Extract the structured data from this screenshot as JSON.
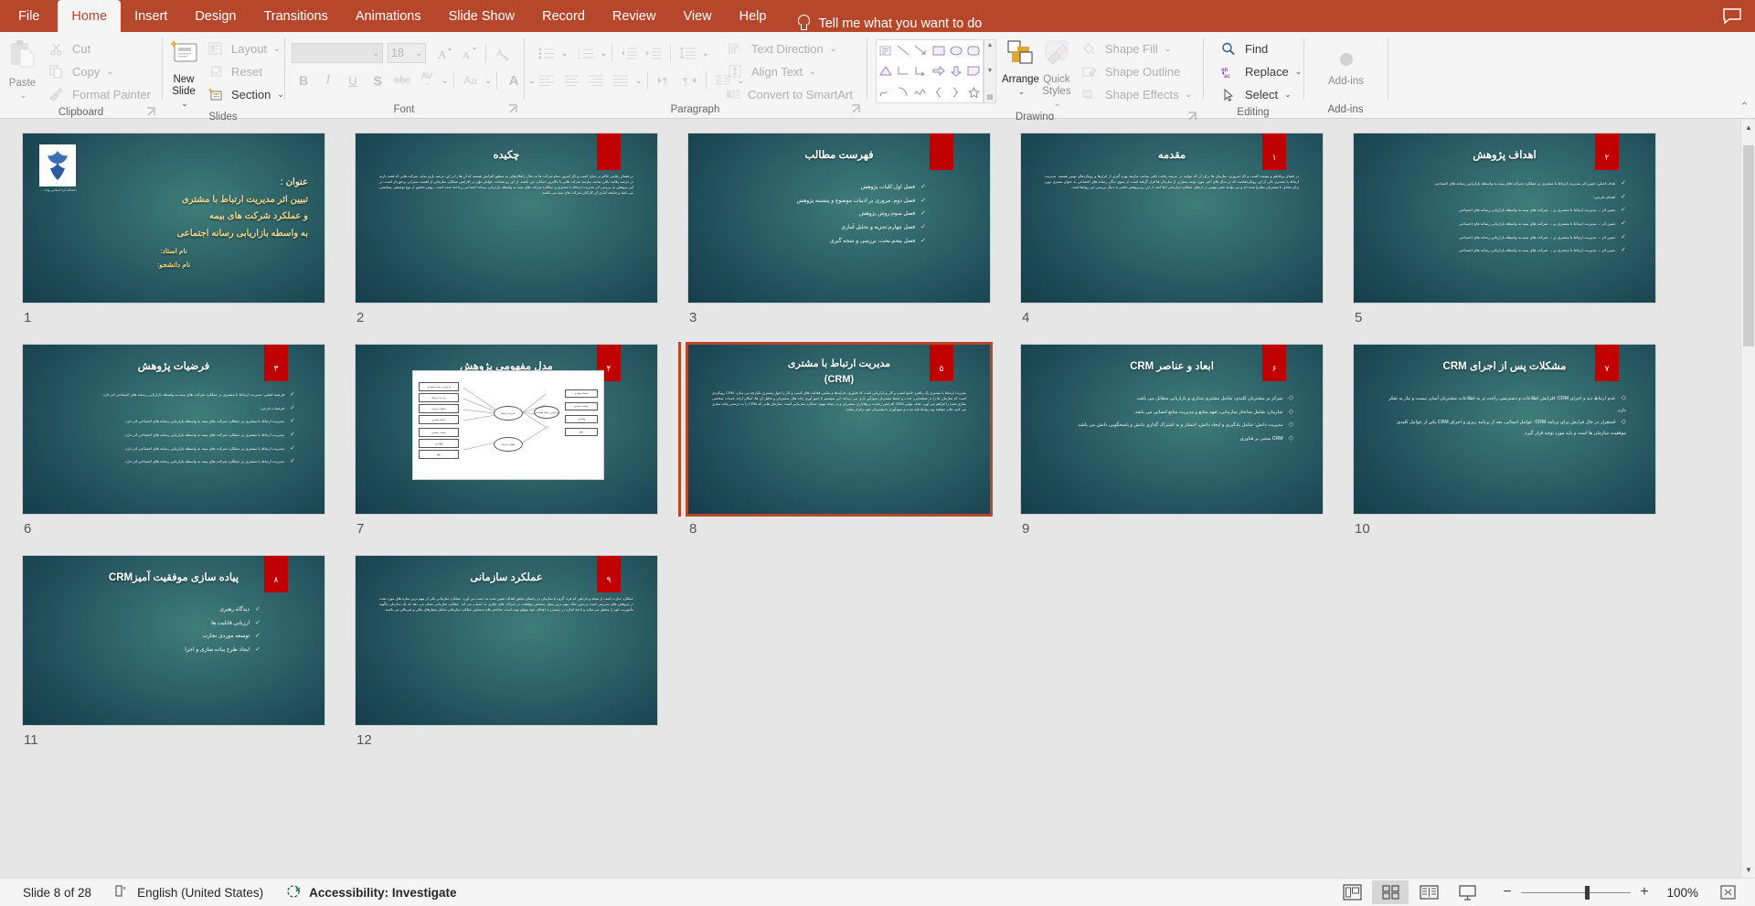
{
  "tabs": [
    {
      "label": "File",
      "active": false
    },
    {
      "label": "Home",
      "active": true
    },
    {
      "label": "Insert",
      "active": false
    },
    {
      "label": "Design",
      "active": false
    },
    {
      "label": "Transitions",
      "active": false
    },
    {
      "label": "Animations",
      "active": false
    },
    {
      "label": "Slide Show",
      "active": false
    },
    {
      "label": "Record",
      "active": false
    },
    {
      "label": "Review",
      "active": false
    },
    {
      "label": "View",
      "active": false
    },
    {
      "label": "Help",
      "active": false
    }
  ],
  "tellme": "Tell me what you want to do",
  "ribbon": {
    "clipboard": {
      "label": "Clipboard",
      "paste": "Paste",
      "cut": "Cut",
      "copy": "Copy",
      "format_painter": "Format Painter"
    },
    "slides": {
      "label": "Slides",
      "new_slide_l1": "New",
      "new_slide_l2": "Slide",
      "layout": "Layout",
      "reset": "Reset",
      "section": "Section"
    },
    "font": {
      "label": "Font",
      "font_name": "",
      "font_size": "18",
      "bold": "B",
      "italic": "I",
      "underline": "U",
      "shadow": "S",
      "strike": "abc",
      "char_spacing": "AV",
      "change_case": "Aa",
      "font_color": "A"
    },
    "paragraph": {
      "label": "Paragraph",
      "text_direction": "Text Direction",
      "align_text": "Align Text",
      "convert_smartart": "Convert to SmartArt"
    },
    "drawing": {
      "label": "Drawing",
      "arrange": "Arrange",
      "quick_styles_l1": "Quick",
      "quick_styles_l2": "Styles",
      "shape_fill": "Shape Fill",
      "shape_outline": "Shape Outline",
      "shape_effects": "Shape Effects"
    },
    "editing": {
      "label": "Editing",
      "find": "Find",
      "replace": "Replace",
      "select": "Select"
    },
    "addins": {
      "label": "Add-ins",
      "button": "Add-ins"
    }
  },
  "status": {
    "slide_indicator": "Slide 8 of 28",
    "language": "English (United States)",
    "accessibility": "Accessibility: Investigate",
    "zoom": "100%"
  },
  "slides": [
    {
      "number": "1",
      "kind": "title",
      "badge": "",
      "logo_caption": "دانشگاه آزاد اسلامی\nواحد ...",
      "title_label": "عنوان :",
      "title_lines": [
        "تبیین اثر مدیریت ارتباط با مشتری",
        "و عملکرد شرکت های بیمه",
        "به واسطه بازاریابی رسانه اجتماعی"
      ],
      "footer_lines": [
        "نام استاد:",
        "نام دانشجو:"
      ]
    },
    {
      "number": "2",
      "kind": "text",
      "badge": "",
      "title": "چکیده",
      "body": "در فضای رقابتی حاکم بر دنیای کسب و کار امروز، تمام شرکت ها به دنبال راهکارهایی به منظور افزایش هستند که آن ها را در این عرصه یاری نماید. شرکت هایی که قصد دارند در عرصه رقابت باقی بمانند، نیازمند شرکت هایی با بالاترین عملکرد می باشند. از این رو شناخت عوامل مؤثر در افزایش عملکرد سازمانی از اهمیت بسزایی برخوردار است. در این پژوهش به بررسی اثر مدیریت ارتباط با مشتری و عملکرد شرکت های بیمه به واسطه بازاریابی رسانه اجتماعی پرداخته شده است. روش تحقیق از نوع توصیفی پیمایشی می باشد و جامعه آماری آن کارکنان شرکت های بیمه می باشند."
    },
    {
      "number": "3",
      "kind": "bullets",
      "badge": "",
      "title": "فهرست مطالب",
      "bullets": [
        "فصل اول:کلیات پژوهش",
        "فصل دوم: مروری بر ادبیات موضوع و پیشینه پژوهش",
        "فصل سوم:روش پژوهش",
        "فصل چهارم:تجزیه و تحلیل آماری",
        "فصل پنجم:بحث، بررسی و نتیجه گیری"
      ]
    },
    {
      "number": "4",
      "kind": "text",
      "badge": "۱",
      "title": "مقدمه",
      "body": "در فضای پرتلاطم و پیچیده کسب و کار امروزی، سازمان ها برای آن که بتوانند در عرصه رقابت باقی بمانند، نیازمند بهره گیری از ابزارها و رویکردهای نوینی هستند. مدیریت ارتباط با مشتری یکی از این رویکردهاست که در سال های اخیر مورد توجه بسیاری از سازمان ها قرار گرفته است. از سوی دیگر، رسانه های اجتماعی به عنوان بستری نوین برای تعامل با مشتریان مطرح شده اند و می توانند نقش مهمی در ارتقای عملکرد سازمانی ایفا کنند. از این رو پژوهش حاضر به دنبال بررسی این روابط است."
    },
    {
      "number": "5",
      "kind": "bullets",
      "badge": "۲",
      "title": "اهداف پژوهش",
      "bullets": [
        "هدف اصلی: تعیین اثر مدیریت ارتباط با مشتری بر عملکرد شرکت های بیمه به واسطه بازاریابی رسانه های اجتماعی",
        "اهداف فرعی:",
        "تعیین اثر ... مدیریت ارتباط با مشتری بر ... شرکت های بیمه به واسطه بازاریابی رسانه های اجتماعی",
        "تعیین اثر ... مدیریت ارتباط با مشتری بر ... شرکت های بیمه به واسطه بازاریابی رسانه های اجتماعی",
        "تعیین اثر ... مدیریت ارتباط با مشتری بر ... شرکت های بیمه به واسطه بازاریابی رسانه های اجتماعی",
        "تعیین اثر ... مدیریت ارتباط با مشتری بر ... شرکت های بیمه به واسطه بازاریابی رسانه های اجتماعی"
      ]
    },
    {
      "number": "6",
      "kind": "bullets",
      "badge": "۳",
      "title": "فرضیات پژوهش",
      "bullets": [
        "فرضیه اصلی: مدیریت ارتباط با مشتری بر عملکرد شرکت های بیمه به واسطه بازاریابی رسانه های اجتماعی اثر دارد.",
        "فرضیات فرعی:",
        "مدیریت ارتباط با مشتری بر عملکرد شرکت های بیمه به واسطه بازاریابی رسانه های اجتماعی اثر دارد.",
        "مدیریت ارتباط با مشتری بر عملکرد شرکت های بیمه به واسطه بازاریابی رسانه های اجتماعی اثر دارد.",
        "مدیریت ارتباط با مشتری بر عملکرد شرکت های بیمه به واسطه بازاریابی رسانه های اجتماعی اثر دارد.",
        "مدیریت ارتباط با مشتری بر عملکرد شرکت های بیمه به واسطه بازاریابی رسانه های اجتماعی اثر دارد."
      ]
    },
    {
      "number": "7",
      "kind": "diagram",
      "badge": "۴",
      "title": "مدل مفهومی پژوهش",
      "diagram_nodes": [
        "بازاریابی رسانه اجتماعی",
        "مدیریت ارتباط",
        "عملکرد شرکت",
        "اعتماد مشتری",
        "رضایت مشتری",
        "وفاداری",
        "تعهد",
        "کیفیت خدمات"
      ]
    },
    {
      "number": "8",
      "kind": "text",
      "badge": "۵",
      "selected": true,
      "title_line1": "مدیریت ارتباط با مشتری",
      "title_line2": "(CRM)",
      "body": "مدیریت ارتباط با مشتری یک راهبرد جامع کسب و کار و بازاریابی است که فناوری، فرآیندها و تمامی فعالیت های کسب و کار را حول مشتری یکپارچه می سازد. CRM رویکردی است که سازمان ها را در شناسایی، جذب و حفظ مشتریان سودآور یاری می رساند. این سیستم با جمع آوری داده های مشتریان و تحلیل آن ها، امکان ارائه خدمات شخصی سازی شده را فراهم می آورد. هدف نهایی CRM افزایش رضایت و وفاداری مشتریان و در نتیجه بهبود عملکرد سازمانی است. سازمان هایی که CRM را به درستی پیاده سازی می کنند، قادر خواهند بود روابط بلند مدت و سودآوری با مشتریان خود برقرار نمایند."
    },
    {
      "number": "9",
      "kind": "bullets",
      "badge": "۶",
      "title": "ابعاد و عناصر CRM",
      "bullets": [
        "تمرکز بر مشتریان کلیدی: شامل مشتری مداری و بازاریابی متقابل می باشد.",
        "سازمان: شامل ساختار سازمانی، تعهد منابع و مدیریت منابع انسانی می باشد.",
        "مدیریت دانش: شامل یادگیری و ایجاد دانش، انتشار و به اشتراک گذاری دانش و پاسخگویی دانش می باشد.",
        "CRM مبتنی بر فناوری"
      ]
    },
    {
      "number": "10",
      "kind": "bullets",
      "badge": "۷",
      "title": "مشکلات پس از اجرای CRM",
      "bullets": [
        "عدم ارتباط دید و اجرای CRM: افزایش اطلاعات و دسترسی راحت تر به اطلاعات مشتریان آسان نیست و نیاز به تفکر دارد.",
        "استقرار در حال فرایش برای برنامه CRM: عوامل انسانی، بعد از برنامه ریزی و اجرای CRM یکی از عوامل کلیدی موفقیت سازمان ها است و باید مورد توجه قرار گیرد."
      ]
    },
    {
      "number": "11",
      "kind": "bullets",
      "badge": "۸",
      "title": "پیاده سازی موفقیت آمیزCRM",
      "bullets": [
        "دیدگاه رهبری",
        "ارزیابی قابلیت ها",
        "توسعه موردی تجارت",
        "ایجاد طرح پیاده سازی و اجرا"
      ]
    },
    {
      "number": "12",
      "kind": "text",
      "badge": "۹",
      "title": "عملکرد سازمانی",
      "body": "عملکرد عبارت است از نتیجه و بازدهی که فرد، گروه یا سازمان در راستای تحقق اهداف تعیین شده به دست می آورد. عملکرد سازمانی یکی از مهم ترین سازه های مورد بحث در پژوهش های مدیریتی است و بدون شک مهم ترین معیار سنجش موفقیت در شرکت های تجاری به حساب می آید. عملکرد سازمانی نشان می دهد که یک سازمان چگونه مأموریت خود را محقق می سازد و تا چه اندازه در رسیدن به اهداف خود موفق بوده است. شاخص های سنجش عملکرد سازمانی شامل معیارهای مالی و غیرمالی می باشند."
    }
  ]
}
